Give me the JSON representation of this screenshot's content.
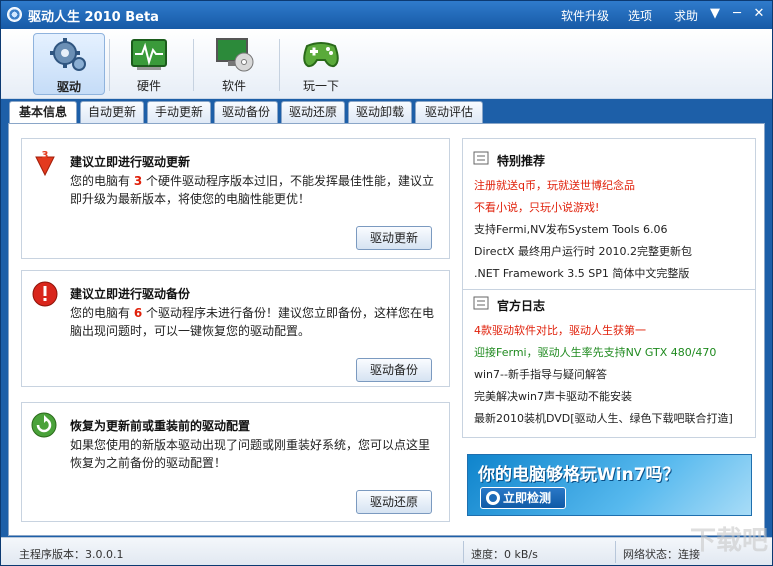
{
  "window": {
    "title": "驱动人生 2010 Beta"
  },
  "top_menu": [
    "软件升级",
    "选项",
    "求助"
  ],
  "toolbar": {
    "items": [
      "驱动",
      "硬件",
      "软件",
      "玩一下"
    ]
  },
  "tabs": [
    "基本信息",
    "自动更新",
    "手动更新",
    "驱动备份",
    "驱动还原",
    "驱动卸载",
    "驱动评估"
  ],
  "panels": {
    "update": {
      "title": "建议立即进行驱动更新",
      "text_before": "您的电脑有 ",
      "count": "3",
      "text_after": " 个硬件驱动程序版本过旧，不能发挥最佳性能，建议立即升级为最新版本，将使您的电脑性能更优！",
      "button": "驱动更新"
    },
    "backup": {
      "title": "建议立即进行驱动备份",
      "text_before": "您的电脑有 ",
      "count": "6",
      "text_after": " 个驱动程序未进行备份！建议您立即备份，这样您在电脑出现问题时，可以一键恢复您的驱动配置。",
      "button": "驱动备份"
    },
    "restore": {
      "title": "恢复为更新前或重装前的驱动配置",
      "text": "如果您使用的新版本驱动出现了问题或刚重装好系统，您可以点这里恢复为之前备份的驱动配置！",
      "button": "驱动还原"
    }
  },
  "recommend": {
    "title": "特别推荐",
    "links": [
      {
        "text": "注册就送q币，玩就送世博纪念品",
        "color": "#e0200a"
      },
      {
        "text": "不看小说，只玩小说游戏!",
        "color": "#e0200a"
      },
      {
        "text": "支持Fermi,NV发布System Tools 6.06",
        "color": "#222222"
      },
      {
        "text": "DirectX 最终用户运行时 2010.2完整更新包",
        "color": "#222222"
      },
      {
        "text": ".NET Framework 3.5 SP1 简体中文完整版",
        "color": "#222222"
      }
    ]
  },
  "blog": {
    "title": "官方日志",
    "links": [
      {
        "text": "4款驱动软件对比，驱动人生获第一",
        "color": "#e0200a"
      },
      {
        "text": "迎接Fermi，驱动人生率先支持NV GTX 480/470",
        "color": "#1f8a1f"
      },
      {
        "text": "win7--新手指导与疑问解答",
        "color": "#222222"
      },
      {
        "text": "完美解决win7声卡驱动不能安装",
        "color": "#222222"
      },
      {
        "text": "最新2010装机DVD[驱动人生、绿色下载吧联合打造]",
        "color": "#222222"
      }
    ]
  },
  "banner": {
    "text": "你的电脑够格玩Win7吗？",
    "button": "立即检测"
  },
  "status": {
    "version_label": "主程序版本：",
    "version": "3.0.0.1",
    "speed_label": "速度：",
    "speed": "0 kB/s",
    "network_label": "网络状态：",
    "network": "连接"
  },
  "watermark": "下载吧"
}
